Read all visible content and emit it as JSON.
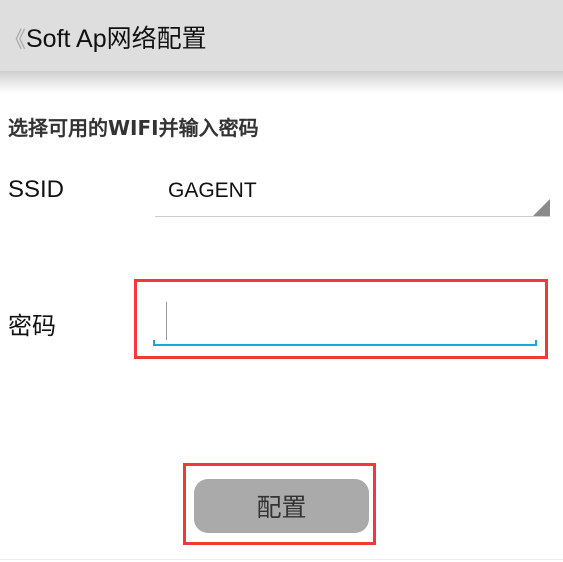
{
  "header": {
    "back_icon": "chevron-left-icon",
    "title": "Soft Ap网络配置"
  },
  "form": {
    "instruction": "选择可用的WIFI并输入密码",
    "ssid_label": "SSID",
    "ssid_value": "GAGENT",
    "password_label": "密码",
    "password_value": "",
    "submit_label": "配置"
  },
  "colors": {
    "header_bg": "#dedede",
    "input_focus": "#1aa7d9",
    "annotation_box": "#f03a3a",
    "button_bg": "#aaaaaa"
  }
}
